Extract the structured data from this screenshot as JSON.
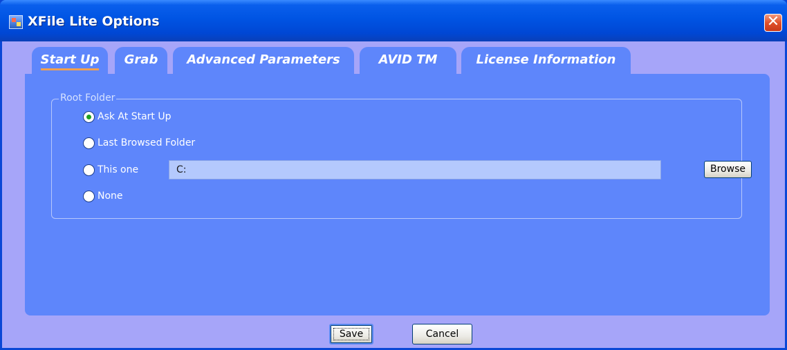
{
  "window": {
    "title": "XFile Lite Options",
    "close_glyph": "✕"
  },
  "tabs": [
    {
      "label": "Start Up",
      "active": true
    },
    {
      "label": "Grab",
      "active": false
    },
    {
      "label": "Advanced Parameters",
      "active": false
    },
    {
      "label": "AVID TM",
      "active": false
    },
    {
      "label": "License Information",
      "active": false
    }
  ],
  "root_folder": {
    "legend": "Root Folder",
    "options": [
      {
        "label": "Ask At Start Up",
        "checked": true
      },
      {
        "label": "Last Browsed Folder",
        "checked": false
      },
      {
        "label": "This one",
        "checked": false
      },
      {
        "label": "None",
        "checked": false
      }
    ],
    "path_value": "C:",
    "browse_label": "Browse"
  },
  "footer": {
    "save_label": "Save",
    "cancel_label": "Cancel"
  },
  "colors": {
    "titlebar": "#0054e3",
    "client_bg": "#a6a5f9",
    "panel_bg": "#5e86fb",
    "path_field_bg": "#b4c9fd",
    "close_button": "#e0502a",
    "radio_checked_dot": "#21a121"
  },
  "icons": [
    "app-icon",
    "close-icon",
    "radio-icon"
  ]
}
